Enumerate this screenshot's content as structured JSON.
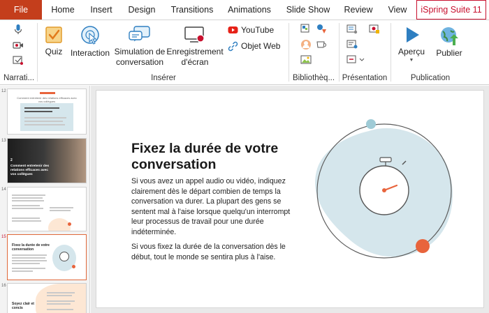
{
  "tabs": [
    {
      "label": "File"
    },
    {
      "label": "Home"
    },
    {
      "label": "Insert"
    },
    {
      "label": "Design"
    },
    {
      "label": "Transitions"
    },
    {
      "label": "Animations"
    },
    {
      "label": "Slide Show"
    },
    {
      "label": "Review"
    },
    {
      "label": "View"
    },
    {
      "label": "iSpring Suite 11"
    }
  ],
  "ribbon": {
    "narration_label": "Narrati...",
    "insert": {
      "quiz": "Quiz",
      "interaction": "Interaction",
      "simulation": "Simulation de conversation",
      "recording": "Enregistrement d'écran",
      "youtube": "YouTube",
      "web_object": "Objet Web",
      "group_label": "Insérer"
    },
    "library_label": "Bibliothèq...",
    "presentation_label": "Présentation",
    "publication": {
      "preview": "Aperçu",
      "publish": "Publier",
      "group_label": "Publication"
    }
  },
  "thumbnails": [
    {
      "number": "12",
      "header_text": "Comment entretenir des relations efficaces avec vos collègues"
    },
    {
      "number": "13",
      "caption": "Comment entretenir des relations efficaces avec vos collègues",
      "step": "2"
    },
    {
      "number": "14"
    },
    {
      "number": "15",
      "caption": "Fixez la durée de votre conversation"
    },
    {
      "number": "16",
      "caption": "Soyez clair et concis"
    }
  ],
  "slide": {
    "title": "Fixez la durée de votre conversation",
    "paragraph1": "Si vous avez un appel audio ou vidéo, indiquez clairement dès le départ combien de temps la conversation va durer. La plupart des gens se sentent mal à l'aise lorsque quelqu'un interrompt leur processus de travail pour une durée indéterminée.",
    "paragraph2": "Si vous fixez la durée de la conversation dès le début, tout le monde se sentira plus à l'aise."
  },
  "colors": {
    "file_tab": "#c43e1c",
    "ispring_tab_border": "#c8102e",
    "blob": "#d5e6ec",
    "accent_orange": "#e8643c",
    "accent_teal": "#9fcbd6",
    "selected_thumb_border": "#e0683a"
  }
}
